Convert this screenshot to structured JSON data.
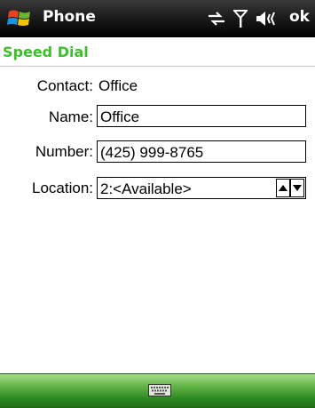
{
  "titlebar": {
    "app_title": "Phone",
    "ok_label": "ok",
    "icons": [
      "start-logo",
      "connectivity-icon",
      "signal-icon",
      "volume-icon"
    ]
  },
  "page": {
    "title": "Speed Dial"
  },
  "form": {
    "contact_label": "Contact:",
    "contact_value": "Office",
    "name_label": "Name:",
    "name_value": "Office",
    "number_label": "Number:",
    "number_value": "(425) 999-8765",
    "location_label": "Location:",
    "location_value": "2:<Available>"
  },
  "colors": {
    "title_green": "#3cbf2a",
    "bottom_bar_green": "#2f8a22"
  }
}
